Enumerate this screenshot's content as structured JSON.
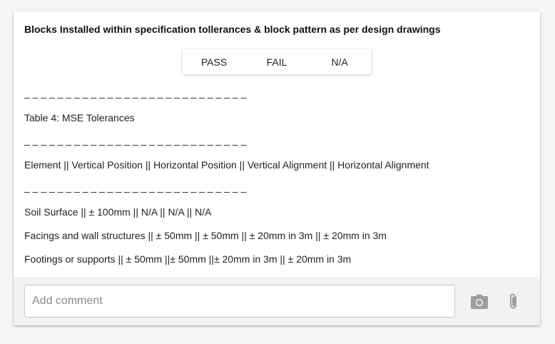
{
  "question": {
    "title": "Blocks Installed within specification tollerances & block pattern as per design drawings"
  },
  "options": [
    {
      "label": "PASS"
    },
    {
      "label": "FAIL"
    },
    {
      "label": "N/A"
    }
  ],
  "notes": {
    "separator": "_ _ _ _ _ _ _ _ _ _ _ _ _ _ _ _ _ _ _ _ _ _ _ _ _ _ _",
    "table_title": "Table 4: MSE Tolerances",
    "header_row": "Element || Vertical Position || Horizontal Position || Vertical Alignment || Horizontal Alignment",
    "rows": [
      "Soil Surface || ± 100mm || N/A || N/A || N/A",
      "Facings and wall structures || ± 50mm || ± 50mm || ± 20mm in 3m || ± 20mm in 3m",
      "Footings or supports || ± 50mm ||± 50mm ||± 20mm in 3m || ± 20mm in 3m"
    ]
  },
  "comment": {
    "placeholder": "Add comment",
    "value": ""
  },
  "icons": {
    "camera": "camera-icon",
    "attach": "paperclip-icon",
    "icon_color": "#9e9e9e"
  }
}
